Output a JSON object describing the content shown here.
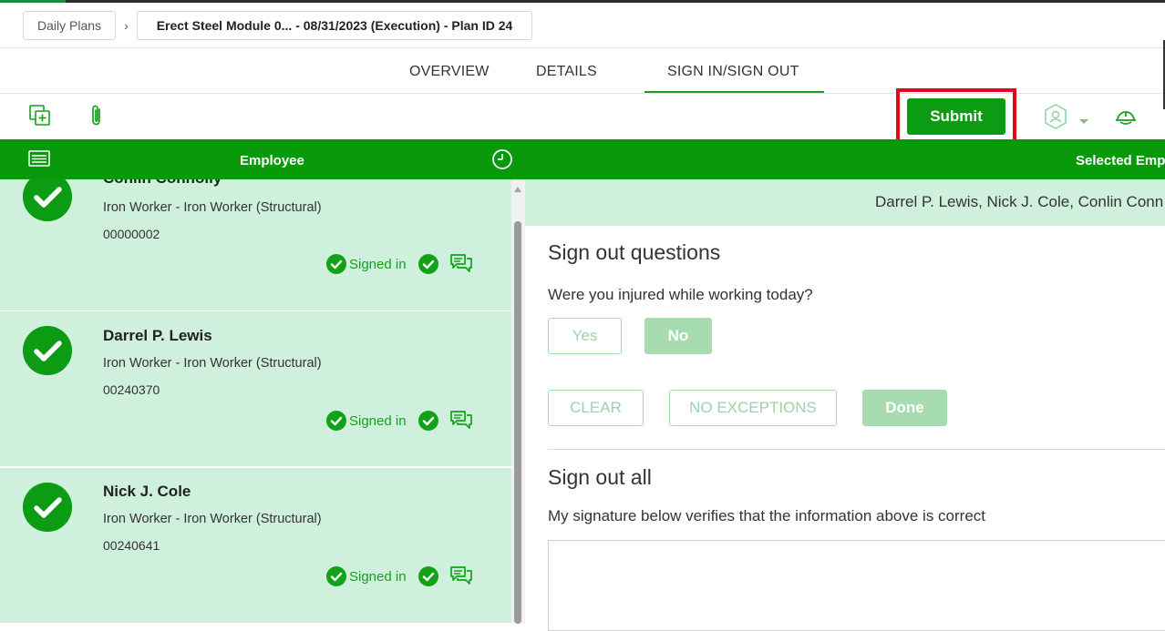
{
  "breadcrumb": {
    "root": "Daily Plans",
    "separator": "›",
    "current": "Erect Steel Module 0... - 08/31/2023 (Execution) - Plan ID 24"
  },
  "tabs": [
    {
      "label": "OVERVIEW"
    },
    {
      "label": "DETAILS"
    },
    {
      "label": "SIGN IN/SIGN OUT",
      "active": true
    }
  ],
  "toolbar": {
    "submit_label": "Submit",
    "icons": [
      "copy-add-icon",
      "paperclip-icon",
      "crew-badge-icon",
      "hardhat-icon"
    ]
  },
  "header": {
    "employee_label": "Employee",
    "selected_label": "Selected Empl",
    "icons": [
      "list-card-icon",
      "clock-icon"
    ]
  },
  "employees": [
    {
      "name": "Conlin Connolly",
      "role": "Iron Worker - Iron Worker (Structural)",
      "number": "00000002",
      "status": "Signed in"
    },
    {
      "name": "Darrel P. Lewis",
      "role": "Iron Worker - Iron Worker (Structural)",
      "number": "00240370",
      "status": "Signed in"
    },
    {
      "name": "Nick J. Cole",
      "role": "Iron Worker - Iron Worker (Structural)",
      "number": "00240641",
      "status": "Signed in"
    }
  ],
  "selected_employees": "Darrel P. Lewis, Nick J. Cole, Conlin Conn",
  "sign_out_questions": {
    "title": "Sign out questions",
    "question": "Were you injured while working today?",
    "yes_label": "Yes",
    "no_label": "No",
    "clear_label": "CLEAR",
    "no_exceptions_label": "NO EXCEPTIONS",
    "done_label": "Done"
  },
  "sign_out_all": {
    "title": "Sign out all",
    "statement": "My signature below verifies that the information above is correct"
  },
  "colors": {
    "brand_green": "#099a0c",
    "card_bg": "#cff0dc",
    "highlight_red": "#e0081a"
  }
}
